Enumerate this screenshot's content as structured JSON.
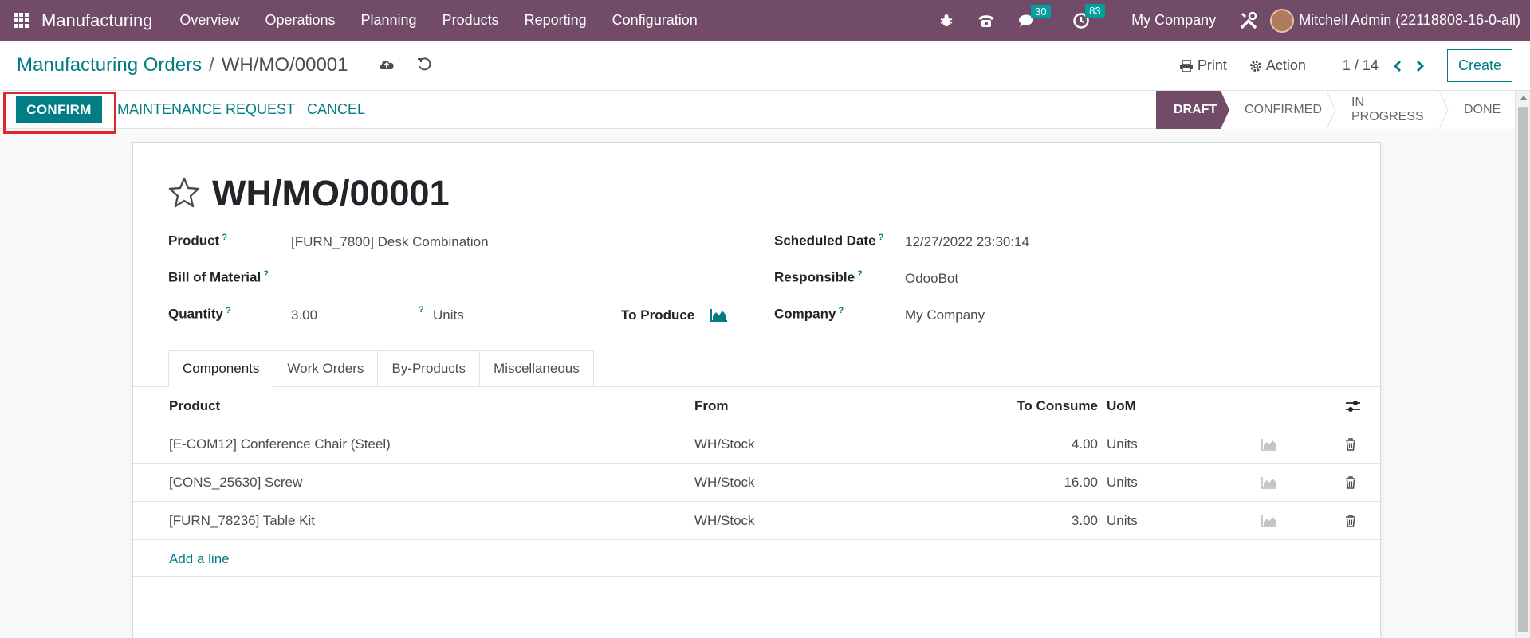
{
  "navbar": {
    "app_name": "Manufacturing",
    "menu": [
      "Overview",
      "Operations",
      "Planning",
      "Products",
      "Reporting",
      "Configuration"
    ],
    "messages_count": "30",
    "activities_count": "83",
    "company": "My Company",
    "user": "Mitchell Admin (22118808-16-0-all)"
  },
  "breadcrumb": {
    "parent": "Manufacturing Orders",
    "separator": "/",
    "current": "WH/MO/00001"
  },
  "control_panel": {
    "print_label": "Print",
    "action_label": "Action",
    "pager": "1 / 14",
    "create_label": "Create"
  },
  "statusbar": {
    "confirm_label": "CONFIRM",
    "maintenance_label": "MAINTENANCE REQUEST",
    "cancel_label": "CANCEL",
    "stages": [
      "DRAFT",
      "CONFIRMED",
      "IN PROGRESS",
      "DONE"
    ],
    "active_stage": "DRAFT"
  },
  "form": {
    "title": "WH/MO/00001",
    "product_label": "Product",
    "product_value": "[FURN_7800] Desk Combination",
    "bom_label": "Bill of Material",
    "quantity_label": "Quantity",
    "quantity_value": "3.00",
    "quantity_uom": "Units",
    "to_produce_label": "To Produce",
    "scheduled_date_label": "Scheduled Date",
    "scheduled_date_value": "12/27/2022 23:30:14",
    "responsible_label": "Responsible",
    "responsible_value": "OdooBot",
    "company_label": "Company",
    "company_value": "My Company",
    "help_mark": "?"
  },
  "tabs": [
    "Components",
    "Work Orders",
    "By-Products",
    "Miscellaneous"
  ],
  "components_table": {
    "headers": {
      "product": "Product",
      "from": "From",
      "to_consume": "To Consume",
      "uom": "UoM"
    },
    "rows": [
      {
        "product": "[E-COM12] Conference Chair (Steel)",
        "from": "WH/Stock",
        "to_consume": "4.00",
        "uom": "Units"
      },
      {
        "product": "[CONS_25630] Screw",
        "from": "WH/Stock",
        "to_consume": "16.00",
        "uom": "Units"
      },
      {
        "product": "[FURN_78236] Table Kit",
        "from": "WH/Stock",
        "to_consume": "3.00",
        "uom": "Units"
      }
    ],
    "add_line_label": "Add a line"
  },
  "colors": {
    "brand": "#714b67",
    "accent": "#017e84",
    "highlight": "#e0262b",
    "badge": "#00a09d"
  }
}
